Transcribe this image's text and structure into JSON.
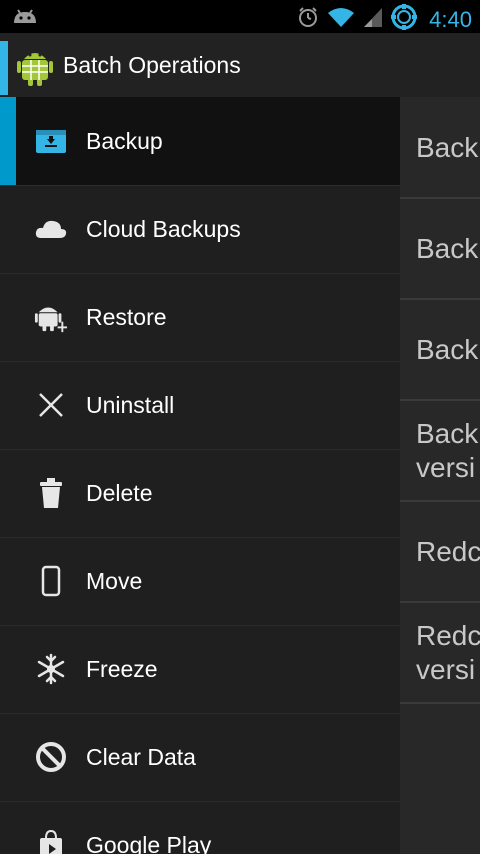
{
  "status_bar": {
    "time": "4:40",
    "icons": [
      "android-notification-icon",
      "alarm-icon",
      "wifi-icon",
      "signal-icon",
      "sync-icon"
    ]
  },
  "action_bar": {
    "title": "Batch Operations"
  },
  "drawer": {
    "items": [
      {
        "label": "Backup",
        "icon": "backup-icon",
        "selected": true
      },
      {
        "label": "Cloud Backups",
        "icon": "cloud-icon"
      },
      {
        "label": "Restore",
        "icon": "android-add-icon"
      },
      {
        "label": "Uninstall",
        "icon": "close-icon"
      },
      {
        "label": "Delete",
        "icon": "trash-icon"
      },
      {
        "label": "Move",
        "icon": "phone-icon"
      },
      {
        "label": "Freeze",
        "icon": "snowflake-icon"
      },
      {
        "label": "Clear Data",
        "icon": "block-icon"
      },
      {
        "label": "Google Play",
        "icon": "shopping-bag-icon"
      }
    ]
  },
  "content": {
    "items": [
      {
        "line1": "Back",
        "line2": ""
      },
      {
        "line1": "Back",
        "line2": ""
      },
      {
        "line1": "Back",
        "line2": ""
      },
      {
        "line1": "Back",
        "line2": "versi"
      },
      {
        "line1": "Redc",
        "line2": ""
      },
      {
        "line1": "Redc",
        "line2": "versi"
      }
    ]
  },
  "colors": {
    "accent": "#33b5e5",
    "selection": "#0099cc"
  }
}
